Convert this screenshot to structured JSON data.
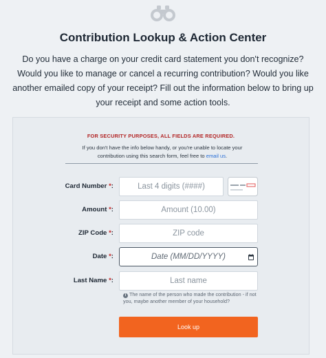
{
  "header": {
    "logo_icon": "binoculars-icon",
    "title": "Contribution Lookup & Action Center",
    "intro": "Do you have a charge on your credit card statement you don't recognize? Would you like to manage or cancel a recurring contribution? Would you like another emailed copy of your receipt? Fill out the information below to bring up your receipt and some action tools."
  },
  "form": {
    "security_notice": "FOR SECURITY PURPOSES, ALL FIELDS ARE REQUIRED.",
    "note_text": "If you don't have the info below handy, or you're unable to locate your contribution using this search form, feel free to ",
    "note_link": "email us",
    "note_end": ".",
    "required_marker": "*",
    "fields": {
      "card_number": {
        "label": "Card Number",
        "placeholder": "Last 4 digits (####)",
        "icon": "credit-card-icon"
      },
      "amount": {
        "label": "Amount",
        "placeholder": "Amount (10.00)"
      },
      "zip": {
        "label": "ZIP Code",
        "placeholder": "ZIP code"
      },
      "date": {
        "label": "Date",
        "placeholder": "Date (MM/DD/YYYY)",
        "icon": "calendar-icon"
      },
      "last_name": {
        "label": "Last Name",
        "placeholder": "Last name",
        "help": "The name of the person who made the contribution - if not you, maybe another member of your household?",
        "help_icon": "info-icon"
      }
    },
    "submit_label": "Look up"
  },
  "colors": {
    "accent": "#f2641f",
    "required": "#c62828",
    "security": "#b22424",
    "link": "#2a6fd6",
    "background": "#eef1f4",
    "panel": "#e8ecf0"
  }
}
